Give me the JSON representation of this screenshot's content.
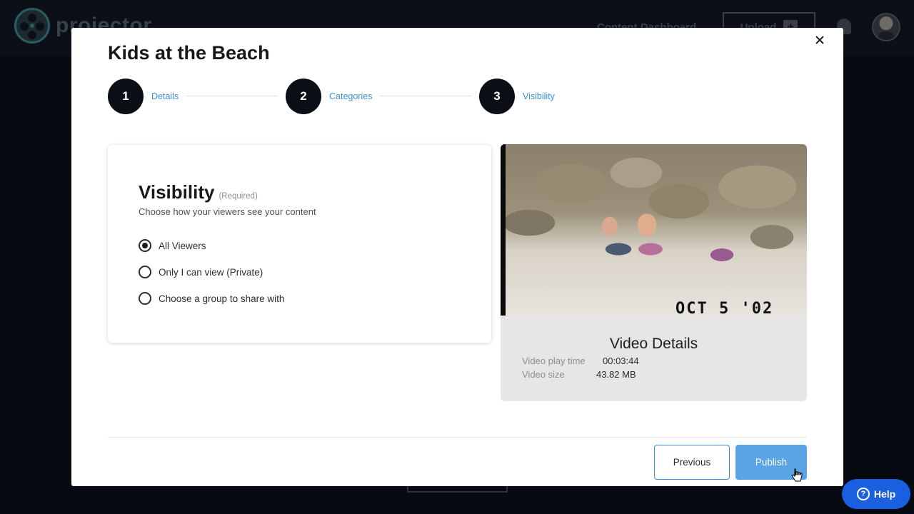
{
  "background": {
    "logo_text": "projector",
    "nav_dashboard": "Content Dashboard",
    "upload_label": "Upload",
    "upload_plus": "+"
  },
  "modal": {
    "title": "Kids at the Beach",
    "close_symbol": "✕",
    "steps": [
      {
        "number": "1",
        "label": "Details"
      },
      {
        "number": "2",
        "label": "Categories"
      },
      {
        "number": "3",
        "label": "Visibility"
      }
    ],
    "visibility": {
      "title": "Visibility",
      "required": "(Required)",
      "subtitle": "Choose how your viewers see your content",
      "options": [
        {
          "label": "All Viewers",
          "checked": true
        },
        {
          "label": "Only I can view (Private)",
          "checked": false
        },
        {
          "label": "Choose a group to share with",
          "checked": false
        }
      ]
    },
    "video": {
      "date_stamp": "OCT  5 '02",
      "details_title": "Video Details",
      "play_time_label": "Video play time",
      "play_time_value": "00:03:44",
      "size_label": "Video size",
      "size_value": "43.82 MB"
    },
    "buttons": {
      "previous": "Previous",
      "publish": "Publish"
    }
  },
  "help": {
    "label": "Help",
    "icon_glyph": "?"
  },
  "colors": {
    "accent": "#3d8fd6",
    "publish_bg": "#5aa4e6",
    "help_bg": "#1a5fe0",
    "overlay": "#070a10"
  }
}
